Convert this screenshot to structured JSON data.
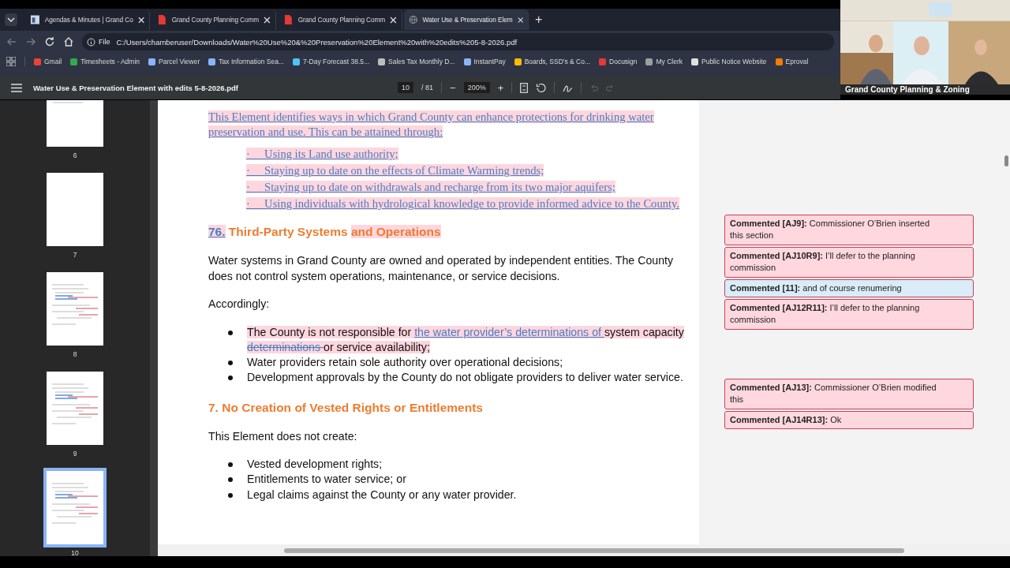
{
  "browser": {
    "tabs": [
      {
        "label": "Agendas & Minutes | Grand Co",
        "selected": false,
        "kind": "site"
      },
      {
        "label": "Grand County Planning Comm",
        "selected": false,
        "kind": "pdf"
      },
      {
        "label": "Grand County Planning Comm",
        "selected": false,
        "kind": "pdf"
      },
      {
        "label": "Water Use & Preservation Elem",
        "selected": true,
        "kind": "globe"
      }
    ],
    "new_tab": "+",
    "address": {
      "scheme": "File",
      "url": "C:/Users/chamberuser/Downloads/Water%20Use%20&%20Preservation%20Element%20with%20edits%205-8-2026.pdf"
    },
    "bookmarks": [
      {
        "label": "Gmail",
        "color": "#ea4335"
      },
      {
        "label": "Timesheets - Admin",
        "color": "#34a853"
      },
      {
        "label": "Parcel Viewer",
        "color": "#8ab4f8"
      },
      {
        "label": "Tax Information Sea...",
        "color": "#8ab4f8"
      },
      {
        "label": "7-Day Forecast 38.5...",
        "color": "#4fc3f7"
      },
      {
        "label": "Sales Tax Monthly D...",
        "color": "#bdbdbd"
      },
      {
        "label": "InstantPay",
        "color": "#8ab4f8"
      },
      {
        "label": "Boards, SSD's & Co...",
        "color": "#fbbc04"
      },
      {
        "label": "Docusign",
        "color": "#e53935"
      },
      {
        "label": "My Clerk",
        "color": "#9e9e9e"
      },
      {
        "label": "Public Notice Website",
        "color": "#e0e0e0"
      },
      {
        "label": "Eproval",
        "color": "#f57c00"
      }
    ]
  },
  "video": {
    "caption": "Grand County Planning & Zoning"
  },
  "pdf_toolbar": {
    "title": "Water Use & Preservation Element with edits 5-8-2026.pdf",
    "page": "10",
    "page_count": "/ 81",
    "zoom": "200%",
    "zoom_out": "−",
    "zoom_in": "+"
  },
  "thumbnails": [
    {
      "label": "6",
      "selected": false,
      "kind": "text"
    },
    {
      "label": "7",
      "selected": false,
      "kind": "blank"
    },
    {
      "label": "8",
      "selected": false,
      "kind": "marked"
    },
    {
      "label": "9",
      "selected": false,
      "kind": "marked"
    },
    {
      "label": "10",
      "selected": true,
      "kind": "marked"
    }
  ],
  "document": {
    "blocks": [
      {
        "kind": "serif_paragraph",
        "segments": [
          {
            "text": "This Element identifies ways in which Grand County can enhance protections for drinking water preservation and use. This can be attained through:",
            "kind": "inserted"
          }
        ]
      },
      {
        "kind": "serif_list",
        "items": [
          {
            "marker": "·",
            "text": "Using its Land use authority;"
          },
          {
            "marker": "·",
            "text": "Staying up to date on the effects of Climate Warming trends;"
          },
          {
            "marker": "·",
            "text": "Staying up to date on withdrawals and recharge from its two major aquifers;"
          },
          {
            "marker": "·",
            "text": "Using individuals with hydrological knowledge to provide informed advice to the County."
          }
        ]
      },
      {
        "kind": "heading",
        "segments": [
          {
            "text": "76.",
            "kind": "inserted"
          },
          {
            "text": " Third-Party Systems ",
            "kind": "normal"
          },
          {
            "text": "and Operations",
            "kind": "highlight"
          }
        ]
      },
      {
        "kind": "paragraph",
        "segments": [
          {
            "text": "Water systems in Grand County are owned and operated by independent entities. The County does not control system operations, maintenance, or service decisions.",
            "kind": "normal"
          }
        ]
      },
      {
        "kind": "paragraph",
        "segments": [
          {
            "text": "Accordingly:",
            "kind": "normal"
          }
        ]
      },
      {
        "kind": "bullet_list",
        "items": [
          {
            "segments": [
              {
                "text": "The County is not responsible for ",
                "kind": "highlight"
              },
              {
                "text": "the water provider’s determinations of ",
                "kind": "inserted"
              },
              {
                "text": "system capacity ",
                "kind": "highlight"
              },
              {
                "text": "determinations ",
                "kind": "deleted"
              },
              {
                "text": "or service availability;",
                "kind": "highlight"
              }
            ]
          },
          {
            "segments": [
              {
                "text": "Water providers retain sole authority over operational decisions;",
                "kind": "normal"
              }
            ]
          },
          {
            "segments": [
              {
                "text": "Development approvals by the County do not obligate providers to deliver water service.",
                "kind": "normal"
              }
            ]
          }
        ]
      },
      {
        "kind": "heading",
        "segments": [
          {
            "text": "7. No Creation of Vested Rights or Entitlements",
            "kind": "normal"
          }
        ]
      },
      {
        "kind": "paragraph",
        "segments": [
          {
            "text": "This Element does not create:",
            "kind": "normal"
          }
        ]
      },
      {
        "kind": "bullet_list",
        "items": [
          {
            "segments": [
              {
                "text": "Vested development rights;",
                "kind": "normal"
              }
            ]
          },
          {
            "segments": [
              {
                "text": "Entitlements to water service; or",
                "kind": "normal"
              }
            ]
          },
          {
            "segments": [
              {
                "text": "Legal claims against the County or any water provider.",
                "kind": "normal"
              }
            ]
          }
        ]
      }
    ]
  },
  "comment_groups": [
    [
      {
        "text": "**Commented [AJ9]:** Commissioner O’Brien inserted this section",
        "color": "#ffd7de"
      },
      {
        "text": "**Commented [AJ10R9]:** I’ll defer to the planning commission",
        "color": "#ffd7de"
      },
      {
        "text": "**Commented [11]:** and of course renumering",
        "color": "#d9ecf7"
      },
      {
        "text": "**Commented [AJ12R11]:** I’ll defer to the planning commission",
        "color": "#ffd7de"
      }
    ],
    [
      {
        "text": "**Commented [AJ13]:** Commissioner O’Brien modified this",
        "color": "#ffd7de"
      },
      {
        "text": "**Commented [AJ14R13]:** Ok",
        "color": "#ffd7de"
      }
    ]
  ]
}
